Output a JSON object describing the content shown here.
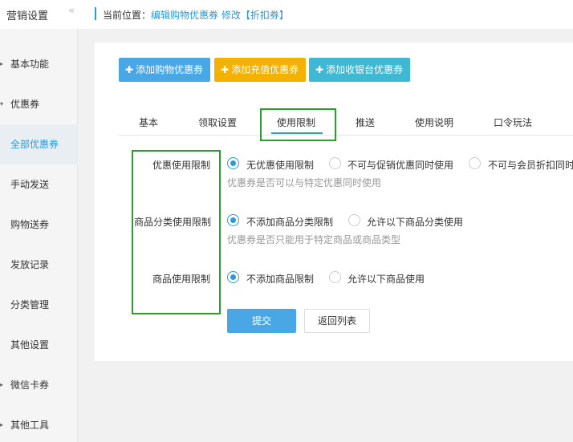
{
  "sidebar": {
    "title": "营销设置",
    "collapse_icon": "«",
    "items": [
      {
        "label": "基本功能",
        "arrow": "▸"
      },
      {
        "label": "优惠券",
        "arrow": "▾"
      },
      {
        "label": "全部优惠券"
      },
      {
        "label": "手动发送"
      },
      {
        "label": "购物送券"
      },
      {
        "label": "发放记录"
      },
      {
        "label": "分类管理"
      },
      {
        "label": "其他设置"
      },
      {
        "label": "微信卡券",
        "arrow": "▸"
      },
      {
        "label": "其他工具",
        "arrow": "▸"
      }
    ]
  },
  "breadcrumb": {
    "label": "当前位置：",
    "path": "编辑购物优惠券 修改【折扣券】"
  },
  "actions": {
    "add_shopping": "添加购物优惠券",
    "add_recharge": "添加充值优惠券",
    "add_cashier": "添加收银台优惠券"
  },
  "tabs": [
    "基本",
    "领取设置",
    "使用限制",
    "推送",
    "使用说明",
    "口令玩法"
  ],
  "form": {
    "coupon_limit": {
      "label": "优惠使用限制",
      "options": [
        "无优惠使用限制",
        "不可与促销优惠同时使用",
        "不可与会员折扣同时"
      ],
      "hint": "优惠券是否可以与特定优惠同时使用"
    },
    "category_limit": {
      "label": "商品分类使用限制",
      "options": [
        "不添加商品分类限制",
        "允许以下商品分类使用"
      ],
      "hint": "优惠券是否只能用于特定商品或商品类型"
    },
    "product_limit": {
      "label": "商品使用限制",
      "options": [
        "不添加商品限制",
        "允许以下商品使用"
      ]
    }
  },
  "buttons": {
    "submit": "提交",
    "back": "返回列表"
  },
  "colors": {
    "accent": "#2a9ad8",
    "blue_button": "#4aa7e6",
    "yellow_button": "#f5b100",
    "cyan_button": "#3fb8d3",
    "highlight_box": "#2aa02a"
  }
}
